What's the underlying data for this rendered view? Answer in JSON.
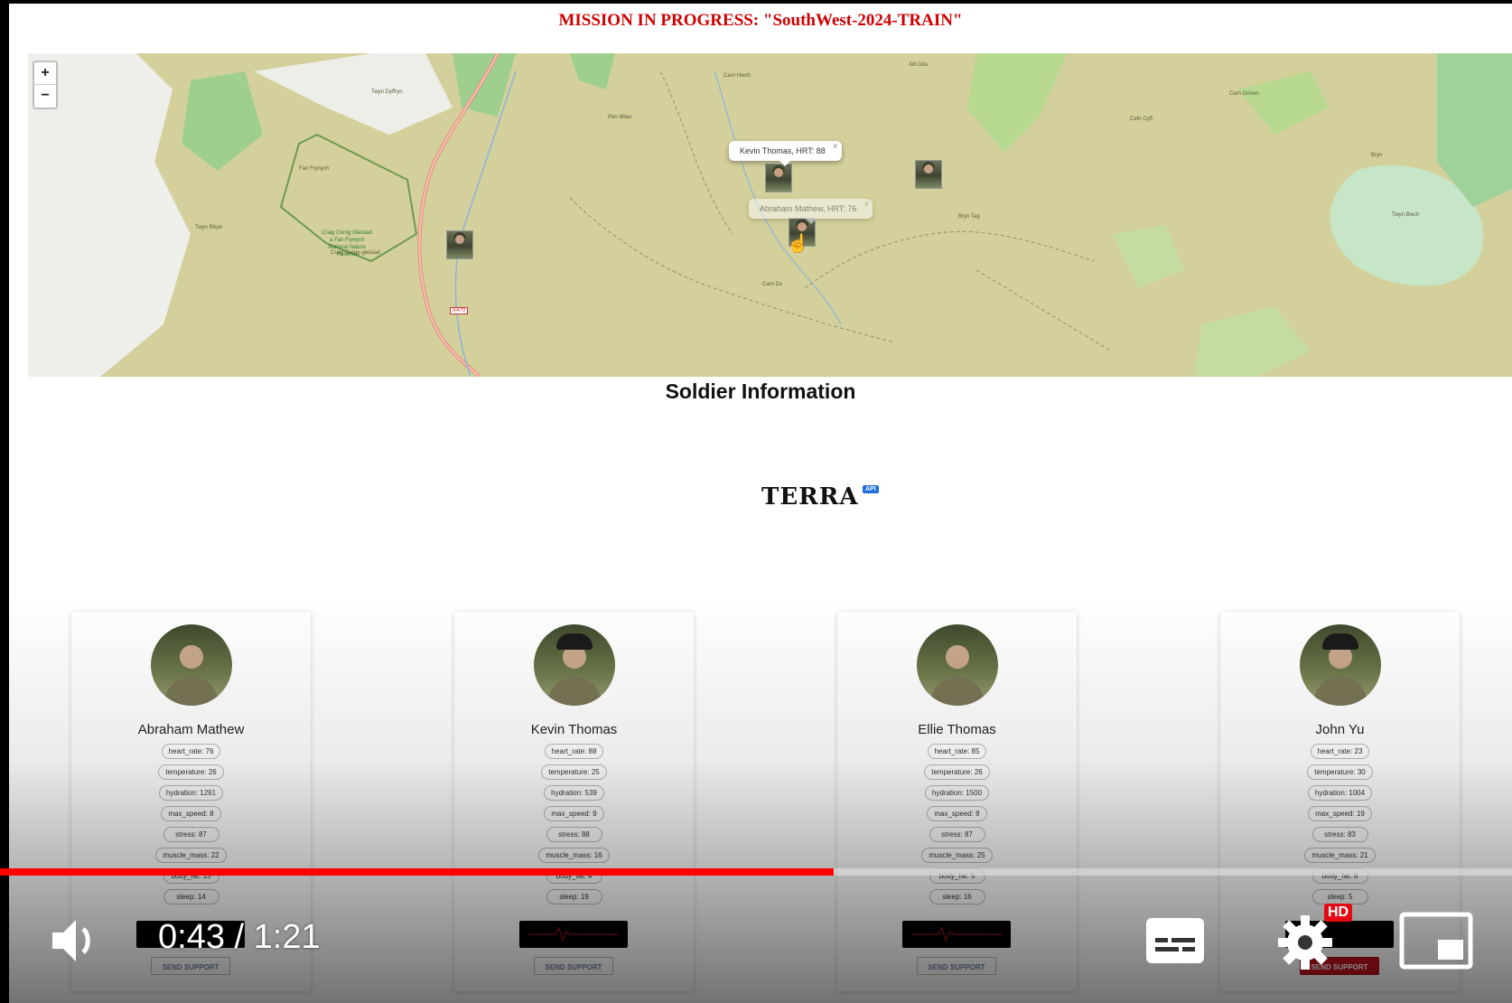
{
  "mission": {
    "title": "MISSION IN PROGRESS: \"SouthWest-2024-TRAIN\""
  },
  "map": {
    "zoom_in": "+",
    "zoom_out": "−",
    "popups": [
      {
        "text": "Kevin Thomas, HRT: 88",
        "close": "×"
      },
      {
        "text": "Abraham Mathew, HRT: 76",
        "close": "×"
      }
    ],
    "road_label": "A470",
    "places": [
      "Twyn Dyffryn",
      "Pen Milan",
      "Carn Hwch",
      "Allt Ddu",
      "Cefn Cyff",
      "Bryn",
      "Twyn Rhyd",
      "Bryn Teg",
      "Carn Du",
      "Fan Frynych",
      "Craig Cerrig-gleisiad",
      "Carn Onnen",
      "Twyn Bwch"
    ],
    "reserve_label": "Craig Cerrig Gleisiad a Fan Frynych National Nature Reserve"
  },
  "section": {
    "heading": "Soldier Information"
  },
  "logo": {
    "word": "TERRA",
    "badge": "API"
  },
  "soldiers": [
    {
      "name": "Abraham Mathew",
      "stats": [
        "heart_rate: 76",
        "temperature: 26",
        "hydration: 1291",
        "max_speed: 8",
        "stress: 87",
        "muscle_mass: 22",
        "body_fat: 13",
        "sleep: 14"
      ],
      "button": "SEND SUPPORT"
    },
    {
      "name": "Kevin Thomas",
      "stats": [
        "heart_rate: 88",
        "temperature: 25",
        "hydration: 539",
        "max_speed: 9",
        "stress: 88",
        "muscle_mass: 16",
        "body_fat: 4",
        "sleep: 19"
      ],
      "button": "SEND SUPPORT"
    },
    {
      "name": "Ellie Thomas",
      "stats": [
        "heart_rate: 85",
        "temperature: 26",
        "hydration: 1500",
        "max_speed: 8",
        "stress: 87",
        "muscle_mass: 25",
        "body_fat: 5",
        "sleep: 16"
      ],
      "button": "SEND SUPPORT"
    },
    {
      "name": "John Yu",
      "stats": [
        "heart_rate: 23",
        "temperature: 30",
        "hydration: 1004",
        "max_speed: 19",
        "stress: 83",
        "muscle_mass: 21",
        "body_fat: 8",
        "sleep: 5"
      ],
      "button": "SEND SUPPORT"
    }
  ],
  "player": {
    "time_current": "0:43",
    "time_separator": "/",
    "time_total": "1:21",
    "progress_fraction": 0.5513,
    "hd_badge": "HD",
    "icons": [
      "volume-icon",
      "captions-icon",
      "settings-icon",
      "miniplayer-icon"
    ],
    "accent_color": "#ff0000"
  }
}
